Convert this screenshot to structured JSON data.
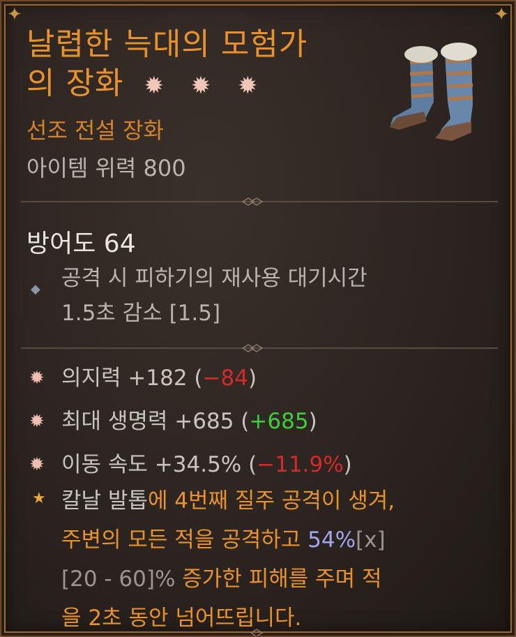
{
  "item": {
    "title_line1": "날렵한 늑대의 모험가",
    "title_line2": "의 장화",
    "rank_stars": "✹ ✹ ✹",
    "rarity": "선조 전설 장화",
    "power": "아이템 위력 800"
  },
  "armor": "방어도 64",
  "implicit": {
    "line1": "공격 시 피하기의 재사용 대기시간",
    "line2": "1.5초 감소 [1.5]"
  },
  "affixes": [
    {
      "base": "의지력 +182 (",
      "delta": "−84",
      "close": ")",
      "delta_type": "negative"
    },
    {
      "base": "최대 생명력 +685 (",
      "delta": "+685",
      "close": ")",
      "delta_type": "positive"
    },
    {
      "base": "이동 속도 +34.5% (",
      "delta": "−11.9%",
      "close": ")",
      "delta_type": "negative"
    }
  ],
  "aspect": {
    "name": "칼날 발톱",
    "text1": "에 4번째 질주 공격이 생겨,",
    "text2": "주변의 모든 적을 공격하고 ",
    "value": "54%",
    "value_suffix": "[x]",
    "range": "[20 - 60]%",
    "text3": " 증가한 피해를 주며 적",
    "text4": "을 2초 동안 넘어뜨립니다."
  },
  "colors": {
    "title": "#e8922e",
    "negative": "#d42a2a",
    "positive": "#3fcc3f",
    "aspect_value": "#a2a6ee",
    "frame_gold": "#c9953f"
  },
  "icons": {
    "affix_marker": "burst-icon",
    "implicit_marker": "diamond-icon",
    "aspect_marker": "star-icon",
    "item_image": "boots-icon"
  }
}
